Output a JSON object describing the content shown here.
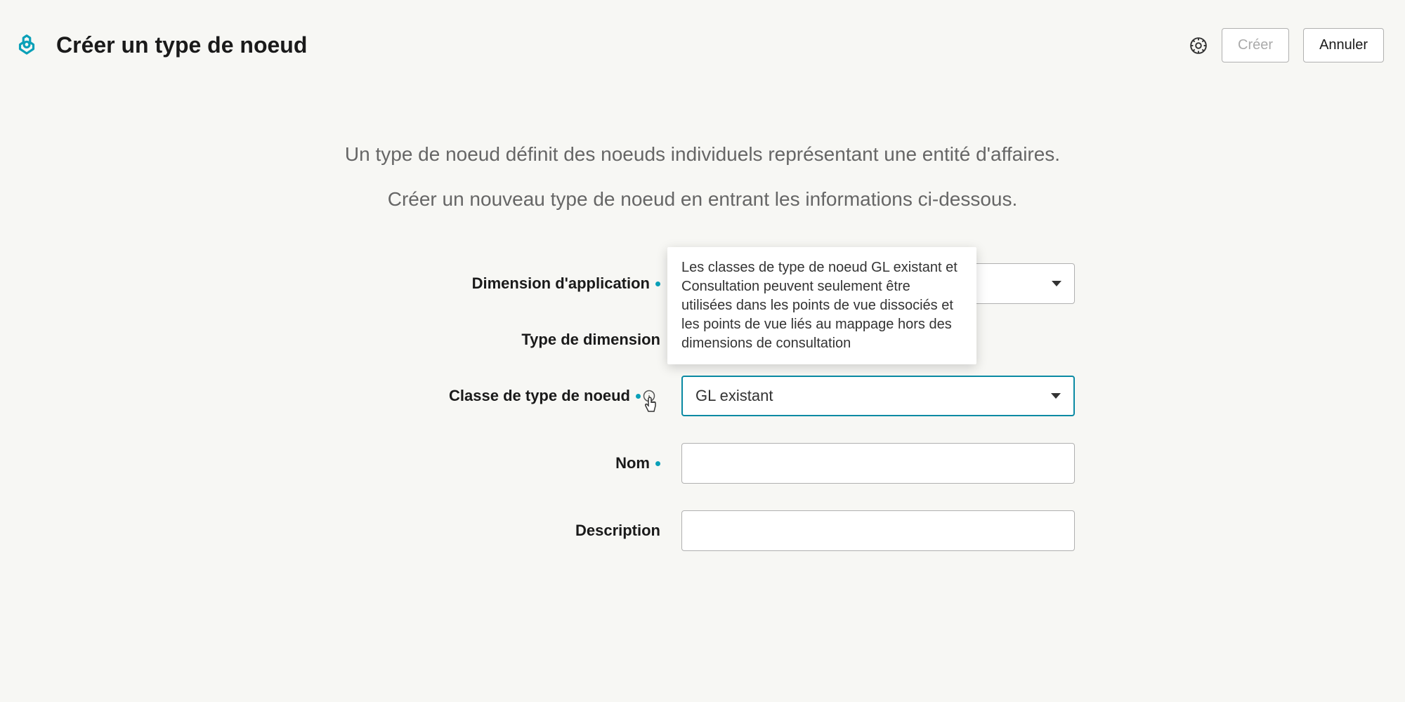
{
  "header": {
    "title": "Créer un type de noeud",
    "create_label": "Créer",
    "cancel_label": "Annuler"
  },
  "intro": {
    "line1": "Un type de noeud définit des noeuds individuels représentant une entité d'affaires.",
    "line2": "Créer un nouveau type de noeud en entrant les informations ci-dessous."
  },
  "form": {
    "app_dimension_label": "Dimension d'application",
    "dimension_type_label": "Type de dimension",
    "class_label": "Classe de type de noeud",
    "class_value": "GL existant",
    "name_label": "Nom",
    "description_label": "Description"
  },
  "tooltip": {
    "text": "Les classes de type de noeud GL existant et Consultation peuvent seulement être utilisées dans les points de vue dissociés et les points de vue liés au mappage hors des dimensions de consultation"
  }
}
